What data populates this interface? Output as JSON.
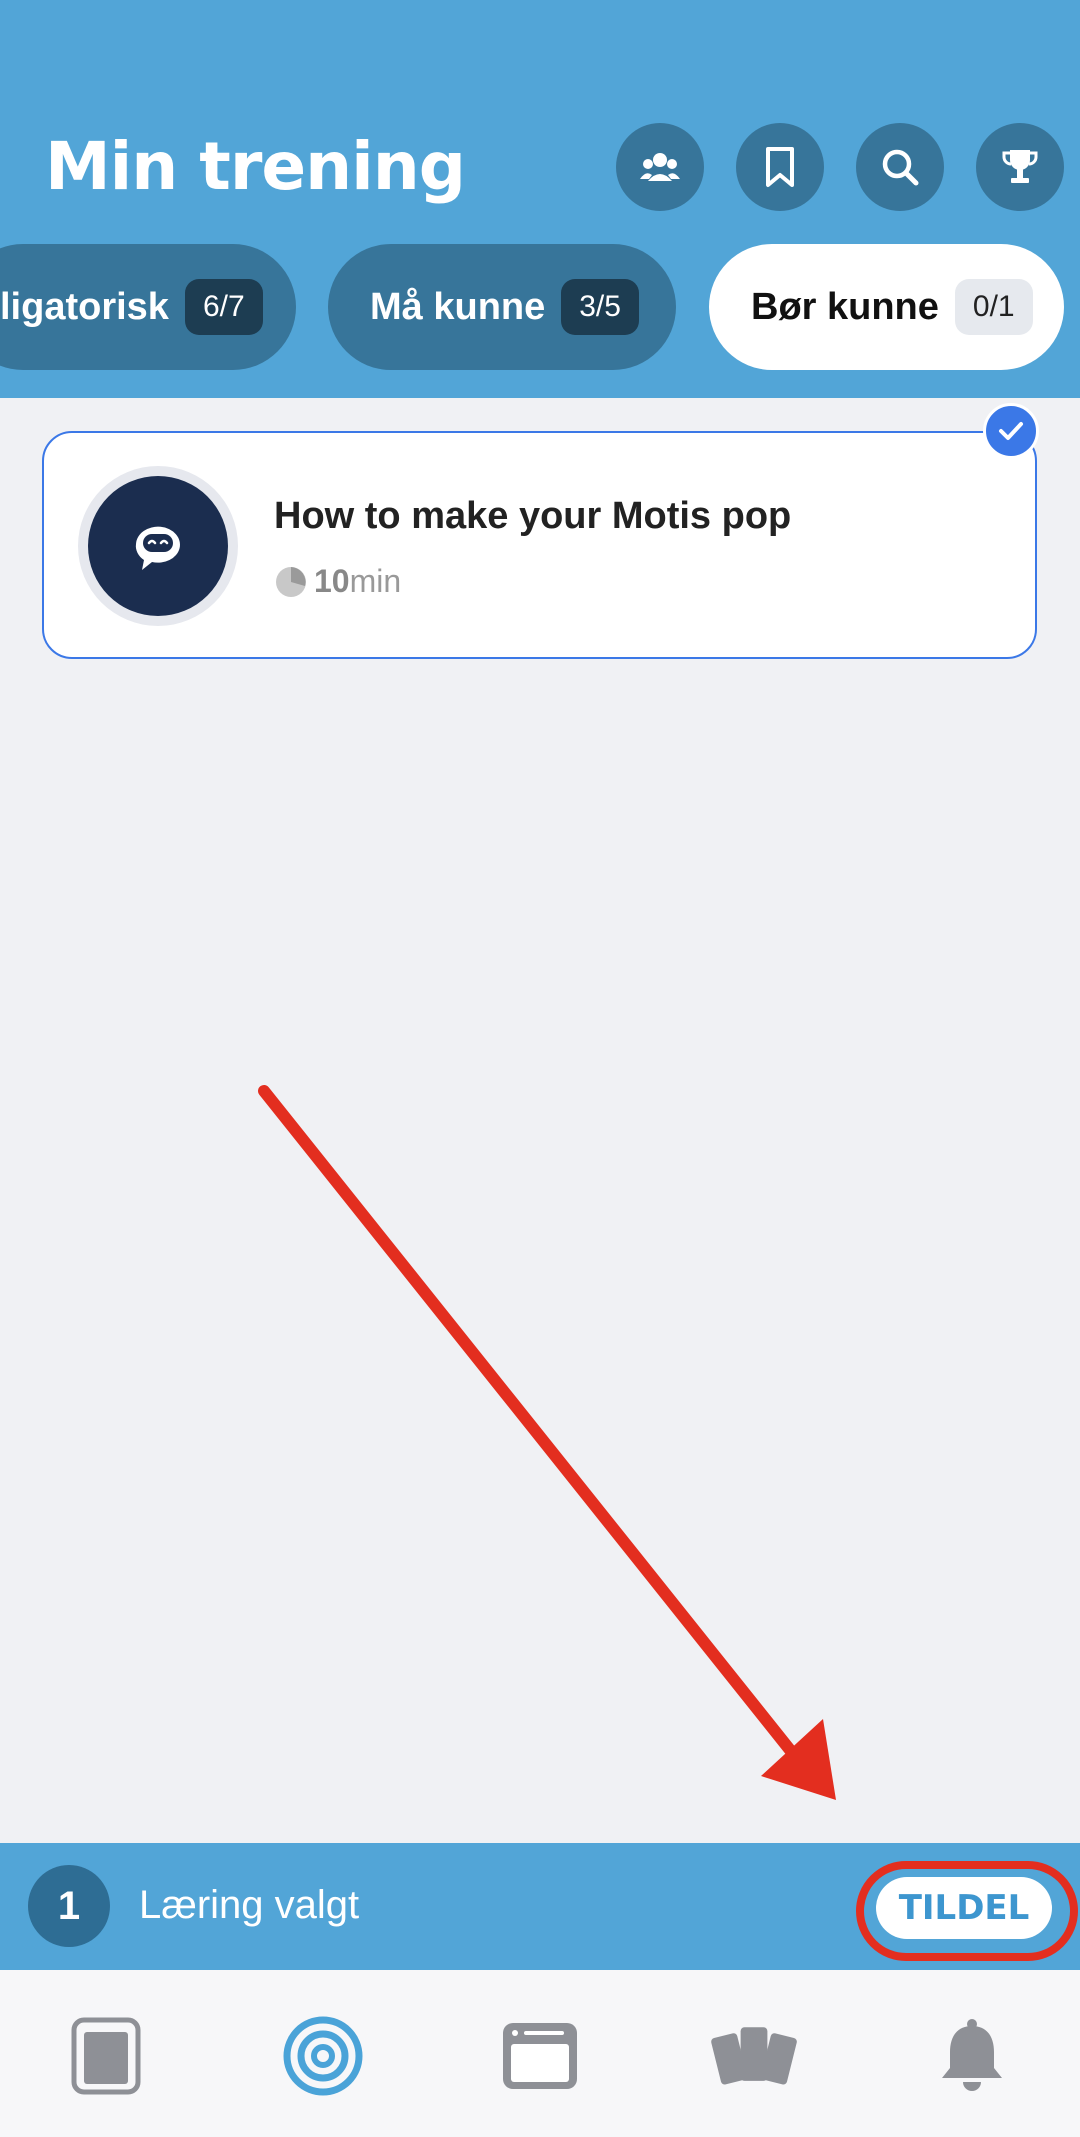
{
  "header": {
    "title": "Min trening",
    "actions": [
      {
        "icon": "team-icon"
      },
      {
        "icon": "bookmark-icon"
      },
      {
        "icon": "search-icon"
      },
      {
        "icon": "trophy-icon"
      }
    ]
  },
  "tabs": [
    {
      "label": "ligatorisk",
      "count": "6/7",
      "active": false
    },
    {
      "label": "Må kunne",
      "count": "3/5",
      "active": false
    },
    {
      "label": "Bør kunne",
      "count": "0/1",
      "active": true
    }
  ],
  "course": {
    "title": "How to make your Motis pop",
    "duration_value": "10",
    "duration_unit": "min",
    "selected": true,
    "icon": "chat-bot-icon"
  },
  "selection_bar": {
    "count": "1",
    "label": "Læring valgt",
    "assign_label": "TILDEL"
  },
  "bottom_nav": [
    {
      "icon": "page-icon",
      "active": false
    },
    {
      "icon": "target-icon",
      "active": true
    },
    {
      "icon": "browser-window-icon",
      "active": false
    },
    {
      "icon": "cards-icon",
      "active": false
    },
    {
      "icon": "bell-icon",
      "active": false
    }
  ],
  "colors": {
    "header_bg": "#52a5d7",
    "tab_bg": "#37759a",
    "accent_blue": "#3b78e7",
    "annotation_red": "#e32e1f"
  }
}
